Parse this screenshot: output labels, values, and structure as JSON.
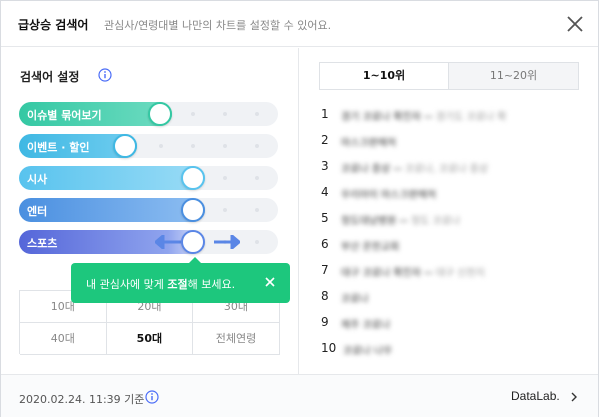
{
  "header": {
    "title": "급상승 검색어",
    "subtitle": "관심사/연령대별 나만의 차트를 설정할 수 있어요."
  },
  "settings": {
    "title": "검색어 설정",
    "sliders": [
      {
        "label": "이슈별 묶어보기",
        "color": "#34c8a3",
        "level": 0.55
      },
      {
        "label": "이벤트 · 할인",
        "color": "#3fb8e3",
        "level": 0.4
      },
      {
        "label": "시사",
        "color": "#7ccff0",
        "level": 0.69
      },
      {
        "label": "엔터",
        "color": "#4a90e2",
        "level": 0.69
      },
      {
        "label": "스포츠",
        "color": "#5566d9",
        "level": 0.69
      }
    ],
    "tooltip": {
      "before": "내 관심사에 맞게 ",
      "bold": "조절",
      "after": "해 보세요."
    },
    "ages": [
      "10대",
      "20대",
      "30대",
      "40대",
      "50대",
      "전체연령"
    ],
    "selected_age": "50대"
  },
  "tabs": [
    "1~10위",
    "11~20위"
  ],
  "ranks": [
    {
      "num": "1",
      "kw": "경기 코로나 확진자",
      "sub": "↔ 경기도 코로나 확"
    },
    {
      "num": "2",
      "kw": "마스크판매처",
      "sub": ""
    },
    {
      "num": "3",
      "kw": "코로나 증상",
      "sub": "↔ 코로나, 코로나 증상"
    },
    {
      "num": "4",
      "kw": "우리아이 마스크판매처",
      "sub": ""
    },
    {
      "num": "5",
      "kw": "청도대남병원",
      "sub": "↔ 청도 코로나"
    },
    {
      "num": "6",
      "kw": "부산 온천교회",
      "sub": ""
    },
    {
      "num": "7",
      "kw": "대구 코로나 확진자",
      "sub": "↔ 대구 신천지"
    },
    {
      "num": "8",
      "kw": "코로나",
      "sub": ""
    },
    {
      "num": "9",
      "kw": "제주 코로나",
      "sub": ""
    },
    {
      "num": "10",
      "kw": "코로나 나우",
      "sub": ""
    }
  ],
  "footer": {
    "timestamp": "2020.02.24. 11:39 기준",
    "brand": "DataLab."
  }
}
